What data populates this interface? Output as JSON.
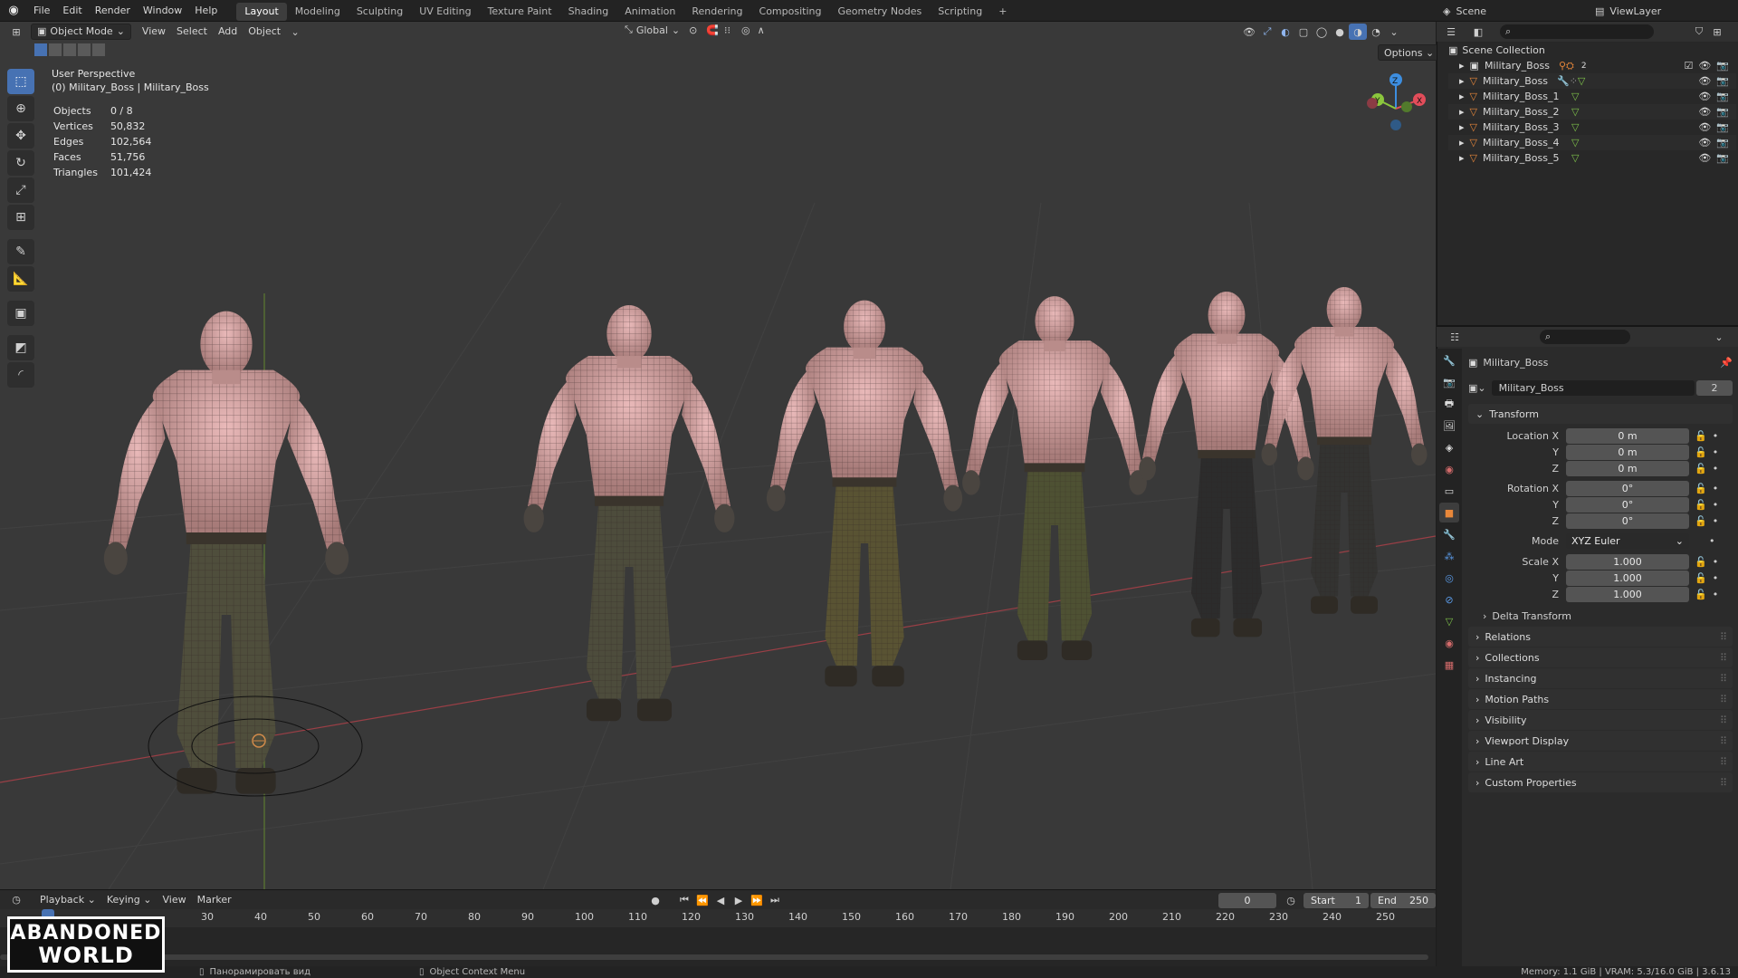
{
  "menu": [
    "File",
    "Edit",
    "Render",
    "Window",
    "Help"
  ],
  "workspaces": [
    "Layout",
    "Modeling",
    "Sculpting",
    "UV Editing",
    "Texture Paint",
    "Shading",
    "Animation",
    "Rendering",
    "Compositing",
    "Geometry Nodes",
    "Scripting"
  ],
  "workspace_add": "+",
  "active_workspace": "Layout",
  "scene": {
    "label": "Scene",
    "view_layer": "ViewLayer"
  },
  "viewport": {
    "mode": "Object Mode",
    "menus": [
      "View",
      "Select",
      "Add",
      "Object"
    ],
    "orientation": "Global",
    "options_label": "Options",
    "info_line1": "User Perspective",
    "info_line2": "(0) Military_Boss | Military_Boss",
    "stats": [
      {
        "label": "Objects",
        "value": "0 / 8"
      },
      {
        "label": "Vertices",
        "value": "50,832"
      },
      {
        "label": "Edges",
        "value": "102,564"
      },
      {
        "label": "Faces",
        "value": "51,756"
      },
      {
        "label": "Triangles",
        "value": "101,424"
      }
    ],
    "gizmo": {
      "x": "X",
      "y": "Y",
      "z": "Z"
    }
  },
  "outliner": {
    "root": "Scene Collection",
    "items": [
      "Military_Boss",
      "Military_Boss",
      "Military_Boss_1",
      "Military_Boss_2",
      "Military_Boss_3",
      "Military_Boss_4",
      "Military_Boss_5"
    ],
    "badge": "2"
  },
  "properties": {
    "object_name": "Military_Boss",
    "data_name": "Military_Boss",
    "data_users": "2",
    "transform_label": "Transform",
    "location": {
      "label": "Location X",
      "x": "0 m",
      "y": "0 m",
      "z": "0 m"
    },
    "rotation": {
      "label": "Rotation X",
      "x": "0°",
      "y": "0°",
      "z": "0°"
    },
    "mode_label": "Mode",
    "mode_value": "XYZ Euler",
    "scale": {
      "label": "Scale X",
      "x": "1.000",
      "y": "1.000",
      "z": "1.000"
    },
    "axis_y": "Y",
    "axis_z": "Z",
    "delta": "Delta Transform",
    "panels": [
      "Relations",
      "Collections",
      "Instancing",
      "Motion Paths",
      "Visibility",
      "Viewport Display",
      "Line Art",
      "Custom Properties"
    ]
  },
  "timeline": {
    "menus": [
      "Playback",
      "Keying",
      "View",
      "Marker"
    ],
    "current_frame": "0",
    "start_label": "Start",
    "start": "1",
    "end_label": "End",
    "end": "250",
    "ticks": [
      "30",
      "40",
      "50",
      "60",
      "70",
      "80",
      "90",
      "100",
      "110",
      "120",
      "130",
      "140",
      "150",
      "160",
      "170",
      "180",
      "190",
      "200",
      "210",
      "220",
      "230",
      "240",
      "250"
    ]
  },
  "status": {
    "hint1": "Панорамировать вид",
    "hint2": "Object Context Menu",
    "memory": "Memory: 1.1 GiB | VRAM: 5.3/16.0 GiB | 3.6.13"
  },
  "watermark": {
    "line1": "ABANDONED",
    "line2": "WORLD"
  },
  "colors": {
    "accent": "#4772b3",
    "x_axis": "#e24d5a",
    "y_axis": "#8bc63d",
    "z_axis": "#3d8ee0",
    "mesh_orange": "#e8873a",
    "mesh_green": "#7ec24a"
  }
}
